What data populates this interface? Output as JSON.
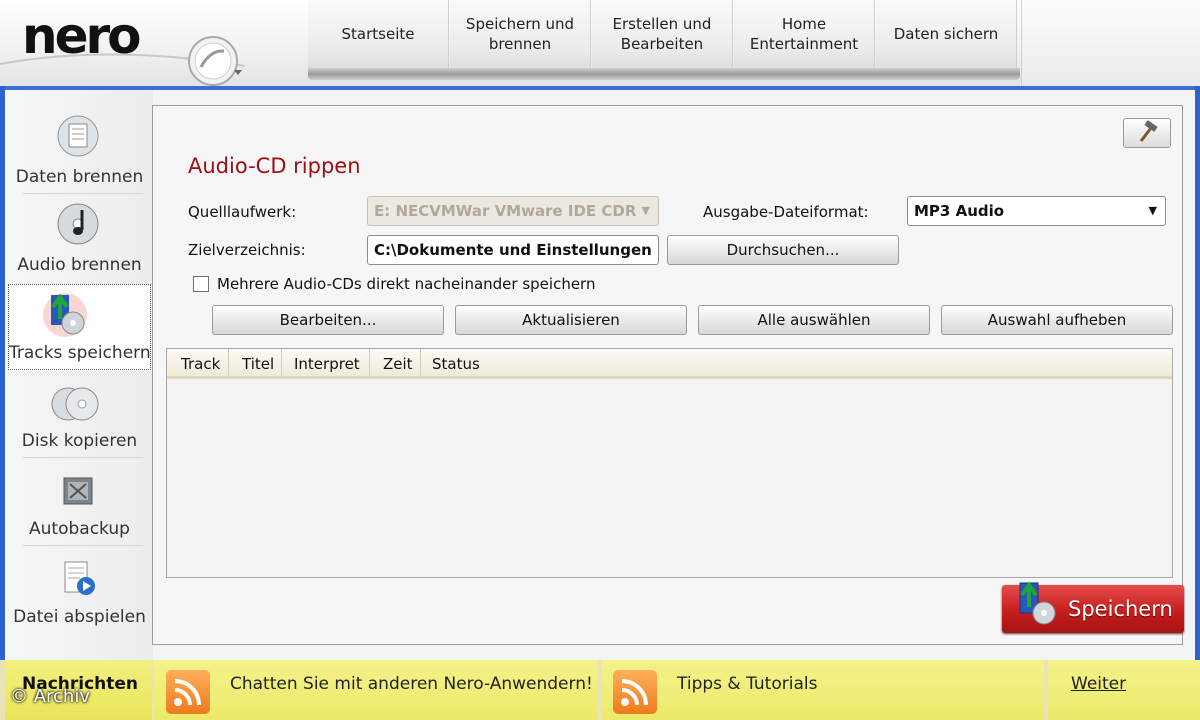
{
  "app": {
    "logo_text": "nero"
  },
  "topnav": {
    "tabs": [
      "Startseite",
      "Speichern und brennen",
      "Erstellen und Bearbeiten",
      "Home Entertainment",
      "Daten sichern"
    ]
  },
  "sidebar": {
    "items": [
      {
        "label": "Daten brennen",
        "icon": "data-disc-icon"
      },
      {
        "label": "Audio brennen",
        "icon": "music-disc-icon"
      },
      {
        "label": "Tracks speichern",
        "icon": "rip-tracks-icon",
        "active": true
      },
      {
        "label": "Disk kopieren",
        "icon": "copy-disc-icon"
      },
      {
        "label": "Autobackup",
        "icon": "backup-icon"
      },
      {
        "label": "Datei abspielen",
        "icon": "play-file-icon"
      }
    ]
  },
  "panel": {
    "title": "Audio-CD rippen",
    "source_label": "Quelllaufwerk:",
    "source_value": "E: NECVMWar VMware IDE CDR",
    "format_label": "Ausgabe-Dateiformat:",
    "format_value": "MP3 Audio",
    "target_label": "Zielverzeichnis:",
    "target_value": "C:\\Dokumente und Einstellungen",
    "browse_label": "Durchsuchen...",
    "multi_label": "Mehrere Audio-CDs direkt nacheinander speichern",
    "buttons": [
      "Bearbeiten...",
      "Aktualisieren",
      "Alle auswählen",
      "Auswahl aufheben"
    ],
    "columns": [
      "Track",
      "Titel",
      "Interpret",
      "Zeit",
      "Status"
    ],
    "save_label": "Speichern"
  },
  "news": {
    "label": "Nachrichten",
    "items": [
      "Chatten Sie mit anderen Nero-Anwendern!",
      "Tipps & Tutorials"
    ],
    "more_label": "Weiter"
  },
  "watermark": "© Archiv",
  "colors": {
    "accent": "#2f63c9",
    "title": "#9b1010",
    "save": "#c51e1e",
    "news": "#ecea6a"
  }
}
